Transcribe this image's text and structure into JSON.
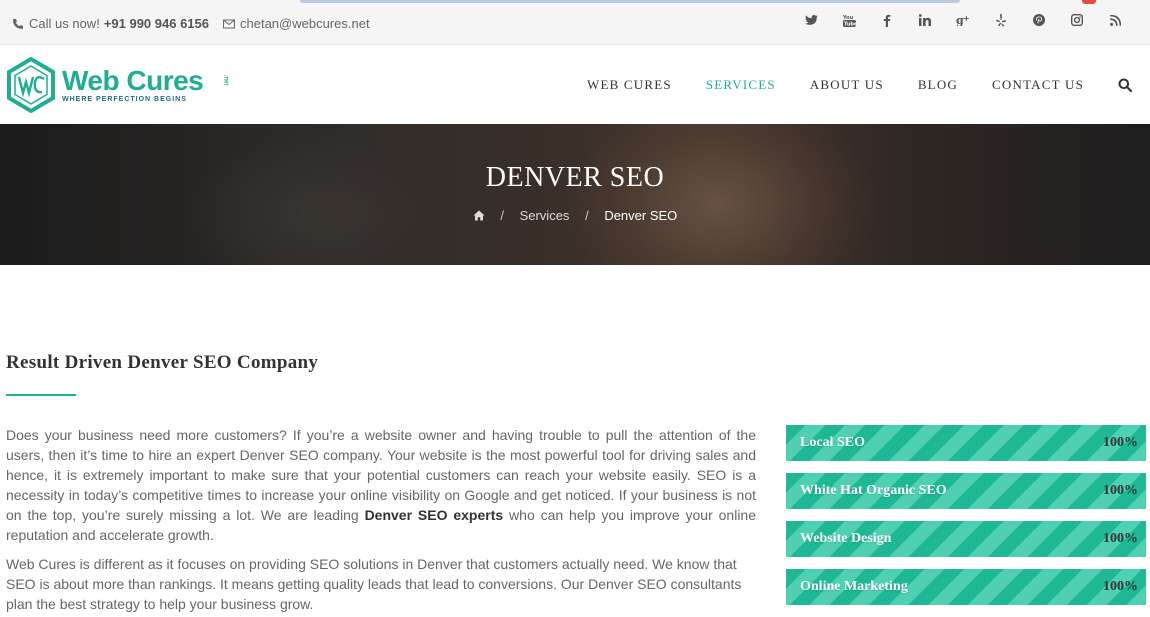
{
  "topbar": {
    "call_label": "Call us now!",
    "phone": "+91 990 946 6156",
    "email": "chetan@webcures.net",
    "social_icons": [
      "twitter-icon",
      "youtube-icon",
      "facebook-icon",
      "linkedin-icon",
      "google-plus-icon",
      "yelp-icon",
      "pinterest-icon",
      "instagram-icon",
      "rss-icon"
    ]
  },
  "logo": {
    "name": "Web Cures",
    "tagline": "WHERE PERFECTION BEGINS",
    "suffix": ".net"
  },
  "nav": {
    "items": [
      "WEB CURES",
      "SERVICES",
      "ABOUT US",
      "BLOG",
      "CONTACT US"
    ],
    "active": "SERVICES"
  },
  "banner": {
    "title": "DENVER SEO",
    "breadcrumb": [
      "Services",
      "Denver SEO"
    ]
  },
  "content": {
    "heading": "Result Driven Denver SEO Company",
    "para1_before": "Does your business need more customers? If you’re a website owner and having trouble to pull the attention of the users, then it’s time to hire an expert Denver SEO company. Your website is the most powerful tool for driving sales and hence, it is extremely important to make sure that your potential customers can reach your website easily. SEO is a necessity in today’s competitive times to increase your online visibility on Google and get noticed. If your business is not on the top, you’re surely missing a lot. We are leading ",
    "para1_bold": "Denver SEO experts",
    "para1_after": " who can help you improve your online reputation and accelerate growth.",
    "para2": "Web Cures is different as it focuses on providing SEO solutions in Denver that customers actually need. We know that SEO is about more than rankings. It means getting quality leads that lead to conversions. Our Denver SEO consultants plan the best strategy to help your business grow."
  },
  "skills": [
    {
      "label": "Local SEO",
      "percent": "100%"
    },
    {
      "label": "White Hat Organic SEO",
      "percent": "100%"
    },
    {
      "label": "Website Design",
      "percent": "100%"
    },
    {
      "label": "Online Marketing",
      "percent": "100%"
    }
  ],
  "colors": {
    "accent": "#1fae90",
    "bar_stripe_light": "#4fd1b1",
    "bar_stripe_dark": "#1fb895"
  }
}
